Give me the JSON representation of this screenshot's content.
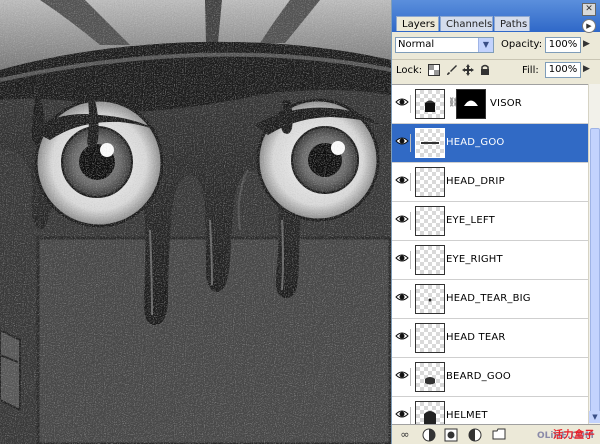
{
  "panel": {
    "tabs": [
      {
        "label": "Layers",
        "active": true
      },
      {
        "label": "Channels",
        "active": false
      },
      {
        "label": "Paths",
        "active": false
      }
    ],
    "close_glyph": "✕",
    "menu_glyph": "▶",
    "blend_mode": "Normal",
    "opacity_label": "Opacity:",
    "opacity_value": "100%",
    "lock_label": "Lock:",
    "fill_label": "Fill:",
    "fill_value": "100%"
  },
  "layers": [
    {
      "name": "VISOR",
      "visible": true,
      "selected": false,
      "has_mask": true
    },
    {
      "name": "HEAD_GOO",
      "visible": true,
      "selected": true,
      "has_mask": false
    },
    {
      "name": "HEAD_DRIP",
      "visible": true,
      "selected": false,
      "has_mask": false
    },
    {
      "name": "EYE_LEFT",
      "visible": true,
      "selected": false,
      "has_mask": false
    },
    {
      "name": "EYE_RIGHT",
      "visible": true,
      "selected": false,
      "has_mask": false
    },
    {
      "name": "HEAD_TEAR_BIG",
      "visible": true,
      "selected": false,
      "has_mask": false
    },
    {
      "name": "HEAD TEAR",
      "visible": true,
      "selected": false,
      "has_mask": false
    },
    {
      "name": "BEARD_GOO",
      "visible": true,
      "selected": false,
      "has_mask": false
    },
    {
      "name": "HELMET",
      "visible": true,
      "selected": false,
      "has_mask": false
    }
  ],
  "watermark": {
    "cn": "活力盒子",
    "en": "OLiHE.COM"
  },
  "colors": {
    "selection": "#316ac5",
    "titlebar": "#2f68c8",
    "panel_bg": "#ece9d8",
    "watermark": "#e8202a"
  },
  "icons": {
    "eye": "eye-icon",
    "lock_transparency": "checkerboard-icon",
    "lock_paint": "brush-icon",
    "lock_move": "move-icon",
    "lock_all": "padlock-icon"
  }
}
